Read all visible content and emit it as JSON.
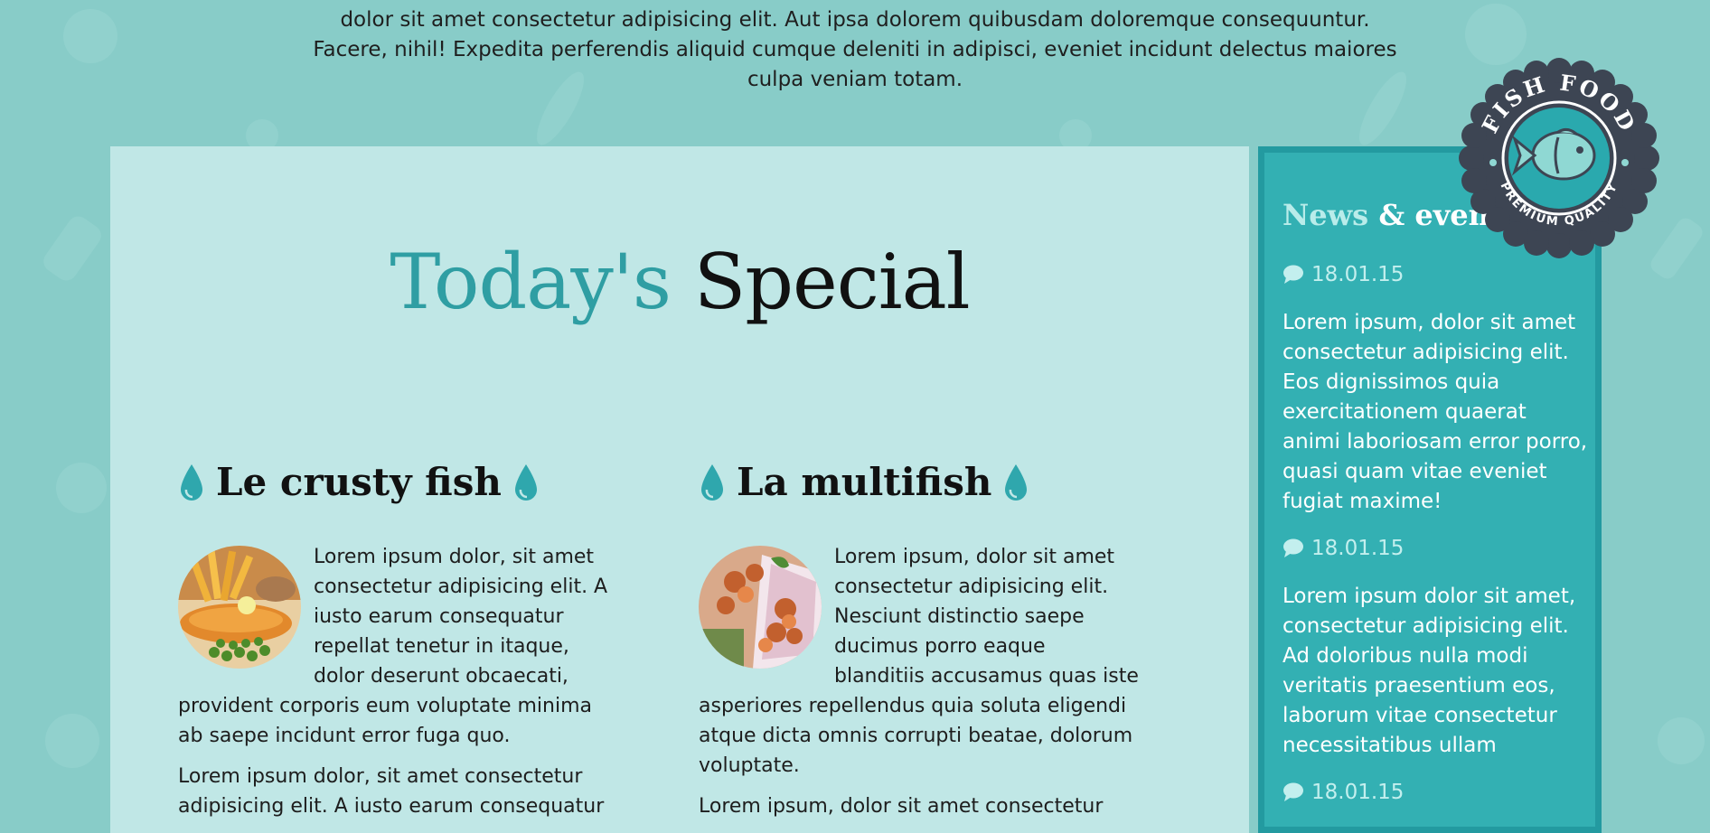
{
  "intro": {
    "line1": "dolor sit amet consectetur adipisicing elit. Aut ipsa dolorem quibusdam doloremque consequuntur.",
    "line2": "Facere, nihil! Expedita perferendis aliquid cumque deleniti in adipisci, eveniet incidunt delectus maiores",
    "line3": "culpa veniam totam."
  },
  "special": {
    "title_part1": "Today's",
    "title_part2": "Special",
    "dishes": [
      {
        "name": "Le crusty fish",
        "para1": "Lorem ipsum dolor, sit amet consectetur adipisicing elit. A iusto earum consequatur repellat tenetur in itaque, dolor deserunt obcaecati, provident corporis eum voluptate minima ab saepe incidunt error fuga quo.",
        "para2": "Lorem ipsum dolor, sit amet consectetur adipisicing elit. A iusto earum consequatur"
      },
      {
        "name": "La multifish",
        "para1": "Lorem ipsum, dolor sit amet consectetur adipisicing elit. Nesciunt distinctio saepe ducimus porro eaque blanditiis accusamus quas iste asperiores repellendus quia soluta eligendi atque dicta omnis corrupti beatae, dolorum voluptate.",
        "para2": "Lorem ipsum, dolor sit amet consectetur"
      }
    ]
  },
  "news": {
    "title_part1": "News",
    "title_part2": "& events",
    "items": [
      {
        "date": "18.01.15",
        "text": "Lorem ipsum, dolor sit amet consectetur adipisicing elit. Eos dignissimos quia exercitationem quaerat animi laboriosam error porro, quasi quam vitae eveniet fugiat maxime!"
      },
      {
        "date": "18.01.15",
        "text": "Lorem ipsum dolor sit amet, consectetur adipisicing elit. Ad doloribus nulla modi veritatis praesentium eos, laborum vitae consectetur necessitatibus ullam"
      },
      {
        "date": "18.01.15",
        "text": ""
      }
    ]
  },
  "badge": {
    "top_text": "FISH FOOD",
    "bottom_text": "PREMIUM QUALITY"
  },
  "colors": {
    "background": "#88ccc8",
    "content_panel": "#c0e7e6",
    "sidebar": "#33b0b3",
    "accent": "#2f9ea3",
    "badge_dark": "#3d4553"
  },
  "icons": {
    "dish_title_icon": "water-drop-icon",
    "news_date_icon": "speech-bubble-icon",
    "badge_icon": "fish-icon"
  }
}
